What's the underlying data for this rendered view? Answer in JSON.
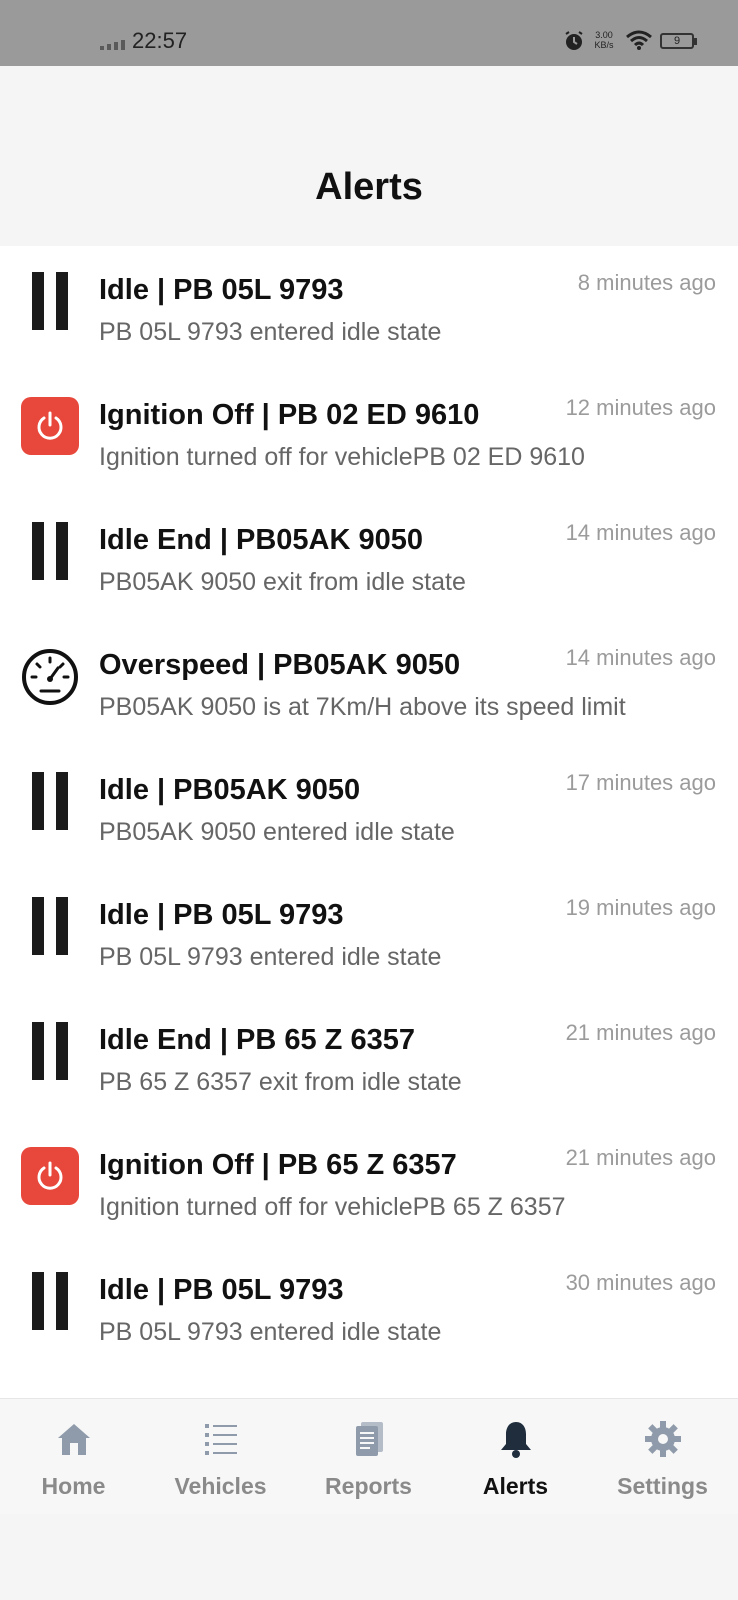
{
  "status_bar": {
    "time": "22:57",
    "net_speed_value": "3.00",
    "net_speed_unit": "KB/s",
    "battery": "9"
  },
  "header": {
    "title": "Alerts"
  },
  "alerts": [
    {
      "type": "idle",
      "icon": "pause-icon",
      "title": "Idle | PB 05L 9793",
      "time": "8 minutes ago",
      "desc": "PB 05L 9793 entered idle state"
    },
    {
      "type": "ignition_off",
      "icon": "power-icon",
      "title": "Ignition Off | PB 02 ED 9610",
      "time": "12 minutes ago",
      "desc": "Ignition turned off for vehiclePB 02 ED 9610"
    },
    {
      "type": "idle_end",
      "icon": "pause-icon",
      "title": "Idle End | PB05AK 9050",
      "time": "14 minutes ago",
      "desc": "PB05AK 9050 exit from idle state"
    },
    {
      "type": "overspeed",
      "icon": "speedometer-icon",
      "title": "Overspeed | PB05AK 9050",
      "time": "14 minutes ago",
      "desc": "PB05AK 9050 is at 7Km/H above its speed limit"
    },
    {
      "type": "idle",
      "icon": "pause-icon",
      "title": "Idle | PB05AK 9050",
      "time": "17 minutes ago",
      "desc": "PB05AK 9050 entered idle state"
    },
    {
      "type": "idle",
      "icon": "pause-icon",
      "title": "Idle | PB 05L 9793",
      "time": "19 minutes ago",
      "desc": "PB 05L 9793 entered idle state"
    },
    {
      "type": "idle_end",
      "icon": "pause-icon",
      "title": "Idle End | PB 65 Z 6357",
      "time": "21 minutes ago",
      "desc": "PB 65 Z 6357 exit from idle state"
    },
    {
      "type": "ignition_off",
      "icon": "power-icon",
      "title": "Ignition Off | PB 65 Z 6357",
      "time": "21 minutes ago",
      "desc": "Ignition turned off for vehiclePB 65 Z 6357"
    },
    {
      "type": "idle",
      "icon": "pause-icon",
      "title": "Idle | PB 05L 9793",
      "time": "30 minutes ago",
      "desc": "PB 05L 9793 entered idle state"
    }
  ],
  "tabs": [
    {
      "label": "Home",
      "icon": "home-icon",
      "active": false
    },
    {
      "label": "Vehicles",
      "icon": "list-icon",
      "active": false
    },
    {
      "label": "Reports",
      "icon": "document-icon",
      "active": false
    },
    {
      "label": "Alerts",
      "icon": "bell-icon",
      "active": true
    },
    {
      "label": "Settings",
      "icon": "gear-icon",
      "active": false
    }
  ],
  "colors": {
    "ignition_icon_bg": "#e8473b",
    "active_tab": "#111111",
    "inactive_tab": "#8a8a8a",
    "time_text": "#9b9b9b"
  }
}
